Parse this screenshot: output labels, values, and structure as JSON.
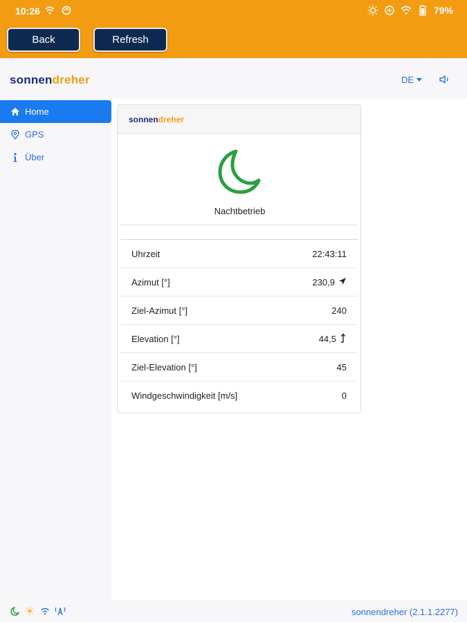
{
  "status": {
    "time": "10:26",
    "battery": "79%"
  },
  "toolbar": {
    "back_label": "Back",
    "refresh_label": "Refresh"
  },
  "header": {
    "brand_part1": "sonnen",
    "brand_part2": "dreher",
    "language": "DE"
  },
  "sidebar": {
    "items": [
      {
        "label": "Home",
        "icon": "home-icon",
        "active": true
      },
      {
        "label": "GPS",
        "icon": "map-marker-icon",
        "active": false
      },
      {
        "label": "Über",
        "icon": "info-icon",
        "active": false
      }
    ]
  },
  "card": {
    "brand_part1": "sonnen",
    "brand_part2": "dreher",
    "mode_icon": "moon-icon",
    "mode_label": "Nachtbetrieb",
    "rows": [
      {
        "label": "Uhrzeit",
        "value": "22:43:11"
      },
      {
        "label": "Azimut [°]",
        "value": "230,9",
        "icon": "navigation-arrow-icon"
      },
      {
        "label": "Ziel-Azimut [°]",
        "value": "240"
      },
      {
        "label": "Elevation [°]",
        "value": "44,5",
        "icon": "elevation-arrow-icon"
      },
      {
        "label": "Ziel-Elevation [°]",
        "value": "45"
      },
      {
        "label": "Windgeschwindigkeit [m/s]",
        "value": "0"
      }
    ]
  },
  "footer": {
    "version": "sonnendreher (2.1.1.2277)"
  },
  "colors": {
    "accent": "#f39c12",
    "brand_blue": "#1a2a7a",
    "link_blue": "#2a6fdb",
    "moon_green": "#2aa040",
    "button_navy": "#0f2a52"
  }
}
